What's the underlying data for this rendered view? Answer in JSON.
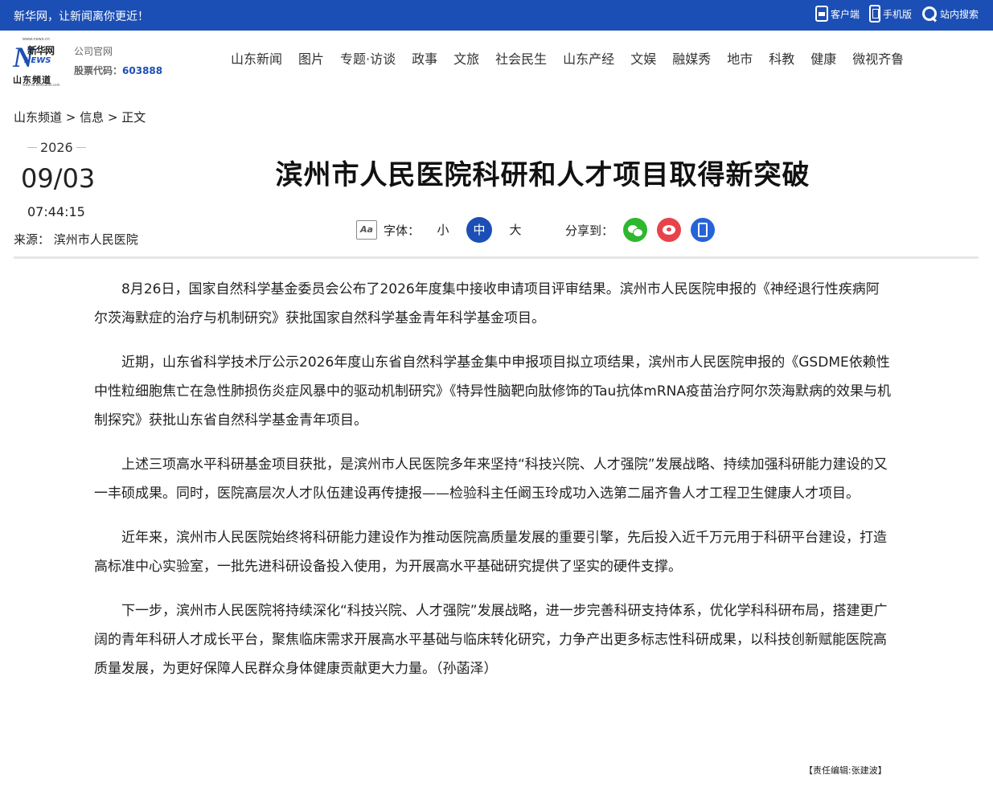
{
  "topbar": {
    "slogan": "新华网，让新闻离你更近！",
    "tools": [
      {
        "label": "客户端",
        "icon": "client-icon"
      },
      {
        "label": "手机版",
        "icon": "mobile-icon"
      },
      {
        "label": "站内搜索",
        "icon": "search-icon"
      }
    ]
  },
  "logo": {
    "brand": "新华网",
    "news": "NEWS",
    "channel": "山东频道",
    "site_top": "www.news.cn",
    "site_bottom": "www.sd.xinhuanet.com"
  },
  "corp": {
    "official_site": "公司官网",
    "stock_label": "股票代码：",
    "stock_code": "603888"
  },
  "nav": [
    "山东新闻",
    "图片",
    "专题·访谈",
    "政事",
    "文旅",
    "社会民生",
    "山东产经",
    "文娱",
    "融媒秀",
    "地市",
    "科教",
    "健康",
    "微视齐鲁"
  ],
  "breadcrumb": {
    "home": "山东频道",
    "sep1": " > ",
    "section": "信息",
    "sep2": " > ",
    "current": "正文"
  },
  "date": {
    "year": "2026",
    "month_day": "09/03",
    "time": "07:44:15"
  },
  "source": "来源： 滨州市人民医院",
  "article": {
    "title": "滨州市人民医院科研和人才项目取得新突破",
    "paragraphs": [
      "8月26日，国家自然科学基金委员会公布了2026年度集中接收申请项目评审结果。滨州市人民医院申报的《神经退行性疾病阿尔茨海默症的治疗与机制研究》获批国家自然科学基金青年科学基金项目。",
      "近期，山东省科学技术厅公示2026年度山东省自然科学基金集中申报项目拟立项结果，滨州市人民医院申报的《GSDME依赖性中性粒细胞焦亡在急性肺损伤炎症风暴中的驱动机制研究》《特异性脑靶向肽修饰的Tau抗体mRNA疫苗治疗阿尔茨海默病的效果与机制探究》获批山东省自然科学基金青年项目。",
      "上述三项高水平科研基金项目获批，是滨州市人民医院多年来坚持“科技兴院、人才强院”发展战略、持续加强科研能力建设的又一丰硕成果。同时，医院高层次人才队伍建设再传捷报——检验科主任阚玉玲成功入选第二届齐鲁人才工程卫生健康人才项目。",
      "近年来，滨州市人民医院始终将科研能力建设作为推动医院高质量发展的重要引擎，先后投入近千万元用于科研平台建设，打造高标准中心实验室，一批先进科研设备投入使用，为开展高水平基础研究提供了坚实的硬件支撑。",
      "下一步，滨州市人民医院将持续深化“科技兴院、人才强院”发展战略，进一步完善科研支持体系，优化学科科研布局，搭建更广阔的青年科研人才成长平台，聚焦临床需求开展高水平基础与临床转化研究，力争产出更多标志性科研成果，以科技创新赋能医院高质量发展，为更好保障人民群众身体健康贡献更大力量。（孙菡泽）"
    ]
  },
  "font_size": {
    "icon_text": "Aa",
    "label": "字体：",
    "options": [
      "小",
      "中",
      "大"
    ],
    "active": "中"
  },
  "share": {
    "label": "分享到：",
    "targets": [
      "wechat-icon",
      "weibo-icon",
      "mobile-share-icon"
    ]
  },
  "editor": "【责任编辑:张建波】"
}
